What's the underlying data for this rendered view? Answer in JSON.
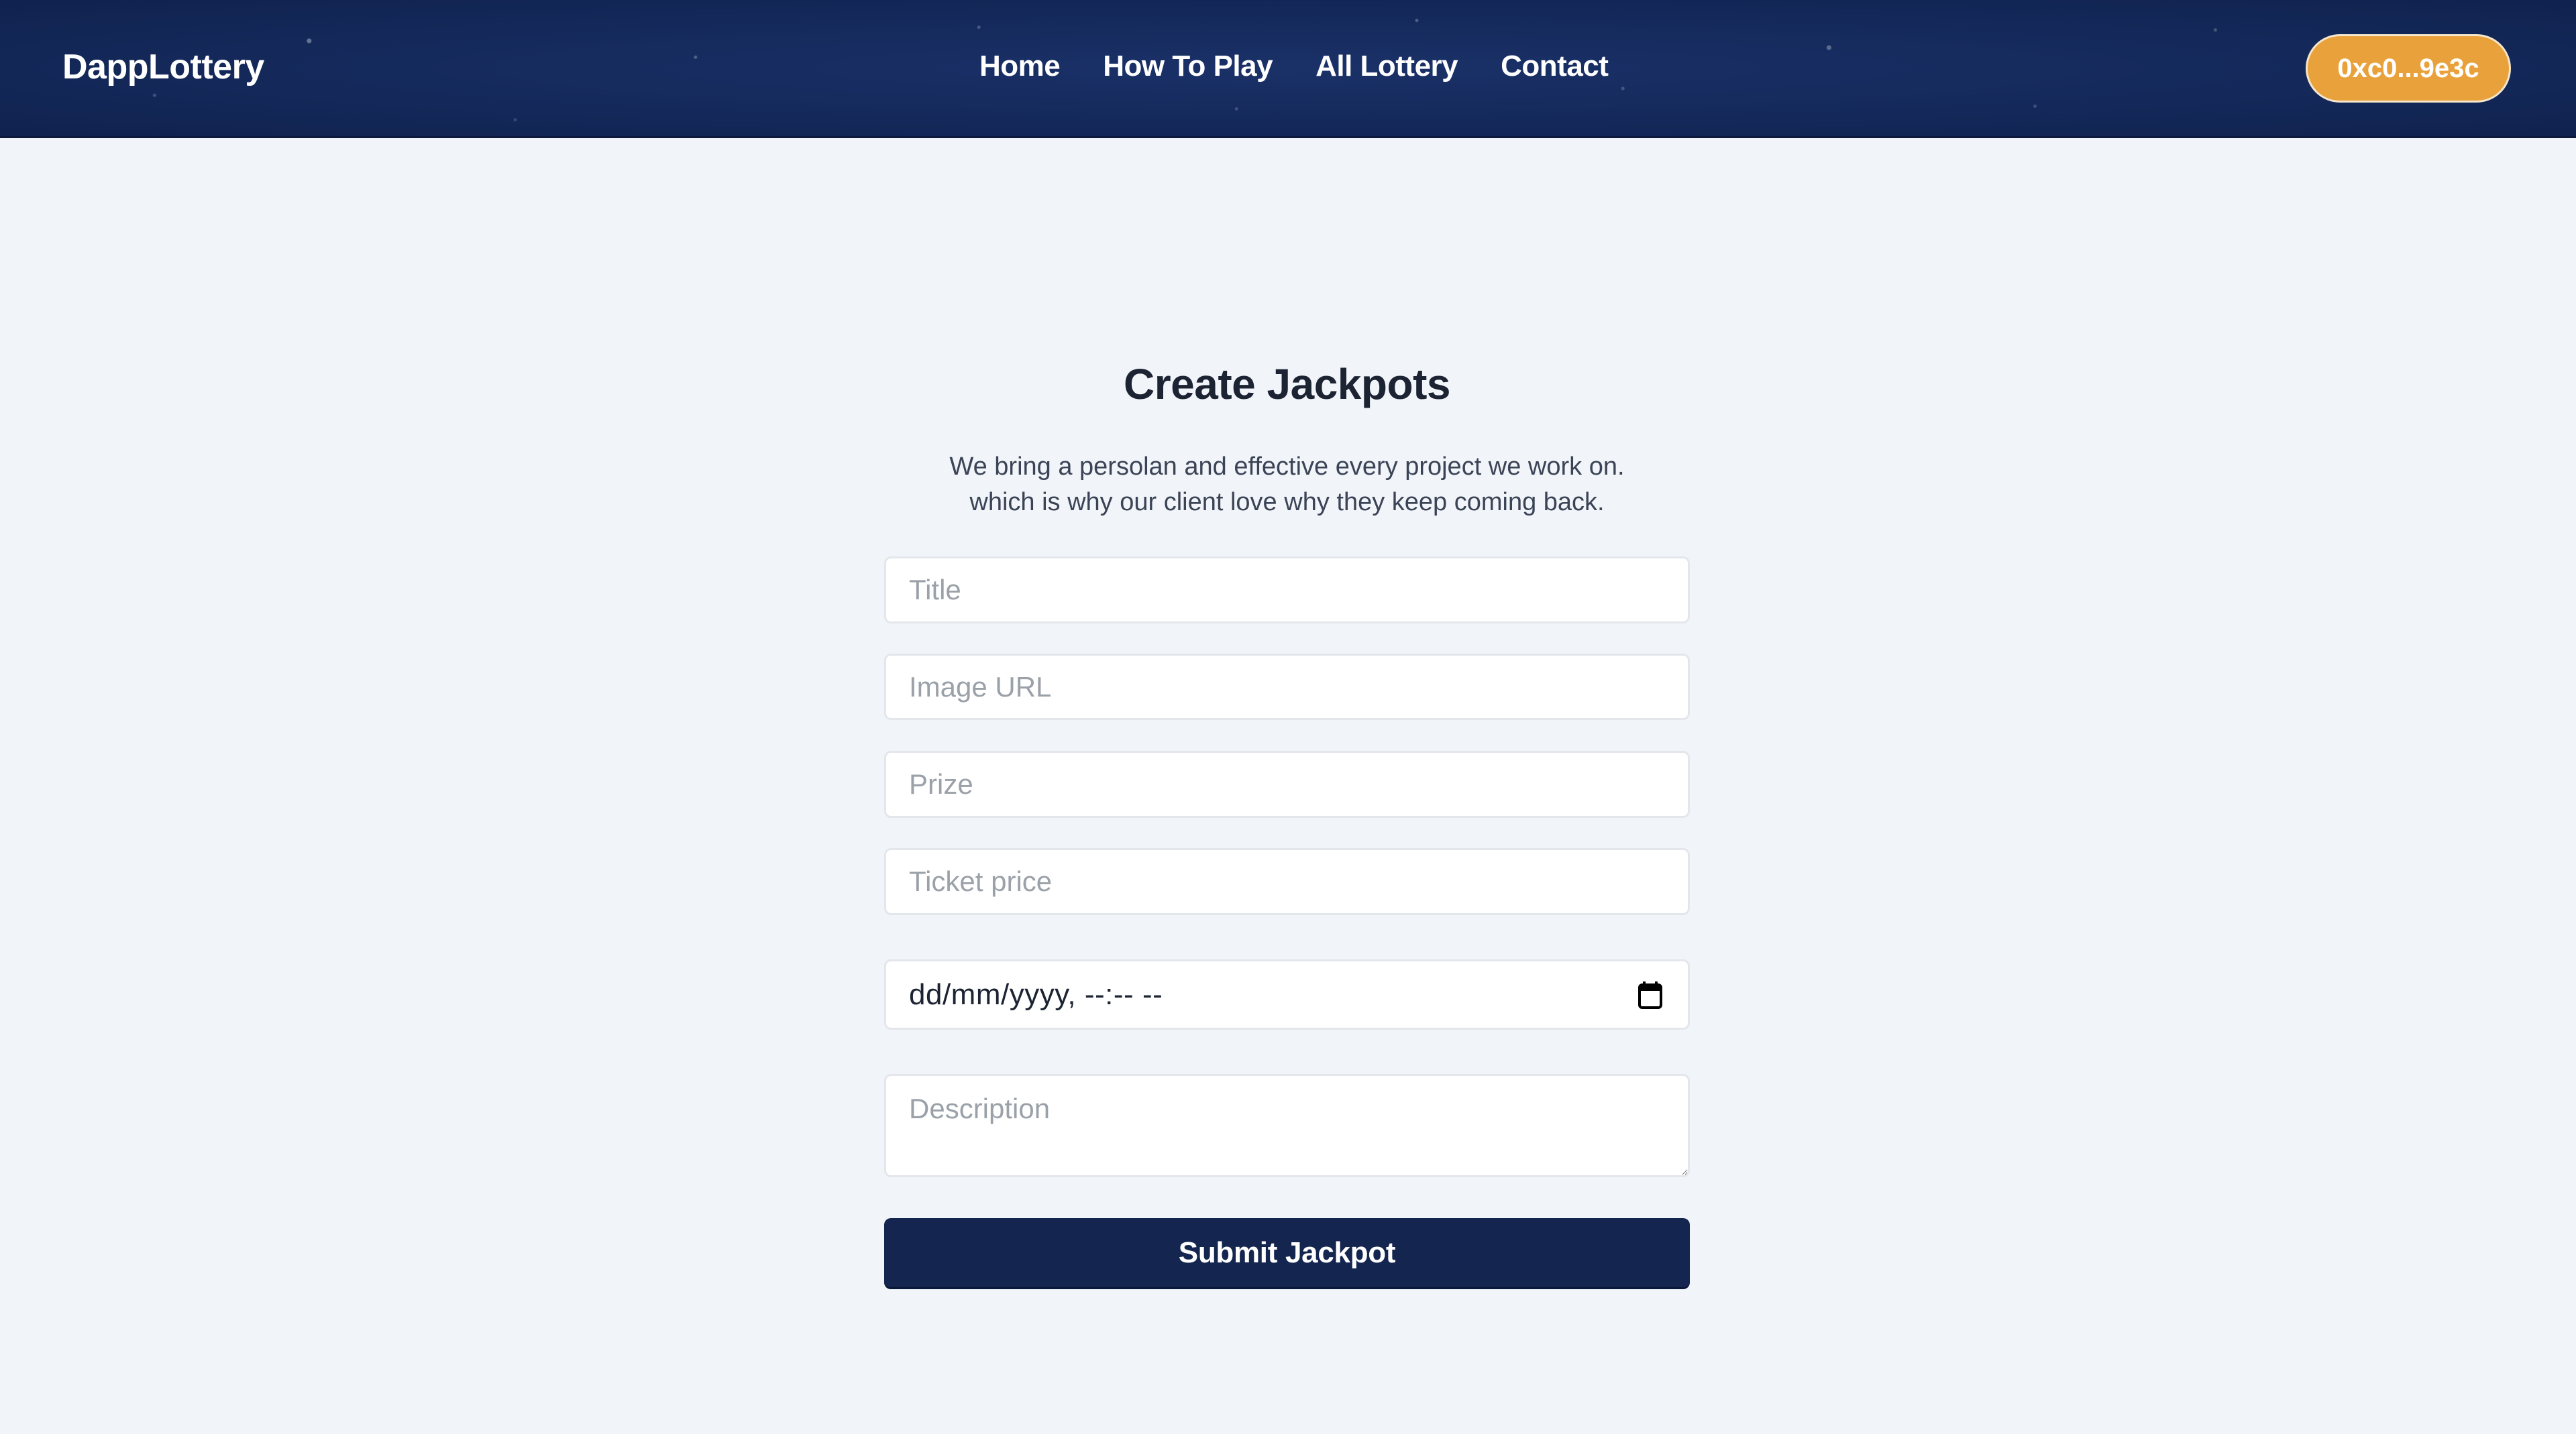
{
  "header": {
    "logo": "DappLottery",
    "nav": [
      {
        "label": "Home"
      },
      {
        "label": "How To Play"
      },
      {
        "label": "All Lottery"
      },
      {
        "label": "Contact"
      }
    ],
    "wallet_address": "0xc0...9e3c"
  },
  "main": {
    "title": "Create Jackpots",
    "subtitle_line1": "We bring a persolan and effective every project we work on.",
    "subtitle_line2": "which is why our client love why they keep coming back.",
    "form": {
      "title": {
        "placeholder": "Title",
        "value": ""
      },
      "image_url": {
        "placeholder": "Image URL",
        "value": ""
      },
      "prize": {
        "placeholder": "Prize",
        "value": ""
      },
      "ticket_price": {
        "placeholder": "Ticket price",
        "value": ""
      },
      "expires_at": {
        "display": "dd/mm/yyyy, --:-- --",
        "icon": "calendar-icon"
      },
      "description": {
        "placeholder": "Description",
        "value": ""
      },
      "submit_label": "Submit Jackpot"
    }
  },
  "colors": {
    "header_bg": "#152a5c",
    "accent_orange": "#e9a23b",
    "submit_bg": "#14264f",
    "page_bg": "#f1f4f8",
    "title_text": "#1c2333"
  }
}
